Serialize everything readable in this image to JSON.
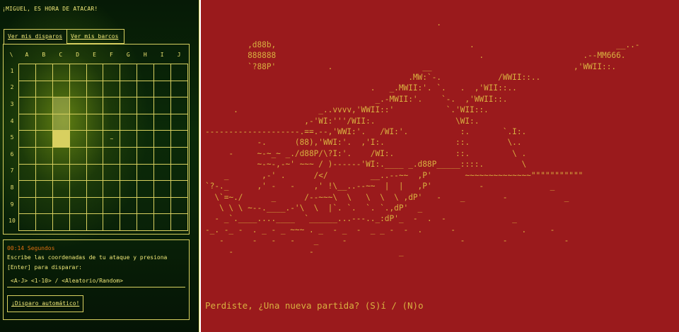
{
  "headline": "¡MIGUEL, ES HORA DE ATACAR!",
  "tabs": [
    {
      "label": "Ver mis disparos",
      "active": true
    },
    {
      "label": "Ver mis barcos",
      "active": false
    }
  ],
  "board": {
    "corner": "\\",
    "columns": [
      "A",
      "B",
      "C",
      "D",
      "E",
      "F",
      "G",
      "H",
      "I",
      "J"
    ],
    "rows": [
      "1",
      "2",
      "3",
      "4",
      "5",
      "6",
      "7",
      "8",
      "9",
      "10"
    ],
    "marks": [
      {
        "col": "F",
        "row": "5",
        "symbol": "~"
      }
    ],
    "hover_cells": [
      {
        "col": "C",
        "row": "3"
      },
      {
        "col": "C",
        "row": "4"
      }
    ],
    "selected_cell": {
      "col": "C",
      "row": "5"
    }
  },
  "info": {
    "timer": "00:14 Segundos",
    "instructions_line1": "Escribe las coordenadas de tu ataque y presiona",
    "instructions_line2": "[Enter] para disparar:",
    "hint": "<A-J> <1-10> / <Aleatorio/Random>",
    "auto_button": "¡Disparo automático!"
  },
  "game_over": {
    "ascii_art": "                                                 .\n\n         ,d88b,                                         .                              __..-\n         888888                                           .                     .--MM666.\n         `?88P'           .                   __                              ,'WWII::.\n                                           .MW:`-.            /WWII::..\n                                   .   _.MWII:'. `.   .  ,'WII::..\n                                    _.-MWII:'.    `-.  ,'WWII::.\n      .                 _..vvvv,'WWII::'           `.'WII::.\n                     ,-'WI:'''/WII:.                 \\WI:.\n--------------------.==.--,'WWI:'.   /WI:'.           :.       `.I:.\n           -.      (88),'WWI:'.  ,'I:.               ::.        \\..\n     -     ~-~_~ _./d88P/\\?I:'.    /WI:.             ::.         \\ .\n           ~-~-,-~' ~~~ / )------'WI:.____ _.d88P_____::::.        \\\n    _       ,-' .      /</         __..--~~  ,P'       ~~~~~~~~~~~~~~\"\"\"\"\"\"\"\"\"\"\"\n`?-._      ,' -   -    ,' !\\__..--~~  |  |   ,P'          -              _\n  \\`=~./      _      /--~~~\\  \\   \\  \\  \\ ,dP'   -    _        -            _\n   \\ \\ \\ ~--.____.-'\\  \\  |`. `.  `. `.,dP'  _\n  - _`.____....____  `______...---.._:dP'_  -  .  -              _\n-_. -_ -  . _ - _ ~~~ . _  - _  -  _ _ -  -  .      -              .     -\n   -      -   -   -    _     -                        -        -            -\n     -                -                  _",
    "prompt": "Perdiste, ¿Una nueva partida? (S)í / (N)o"
  },
  "colors": {
    "left_accent": "#d8d060",
    "timer": "#e07010",
    "right_background": "#9a1a1c",
    "right_text": "#d8b040"
  }
}
